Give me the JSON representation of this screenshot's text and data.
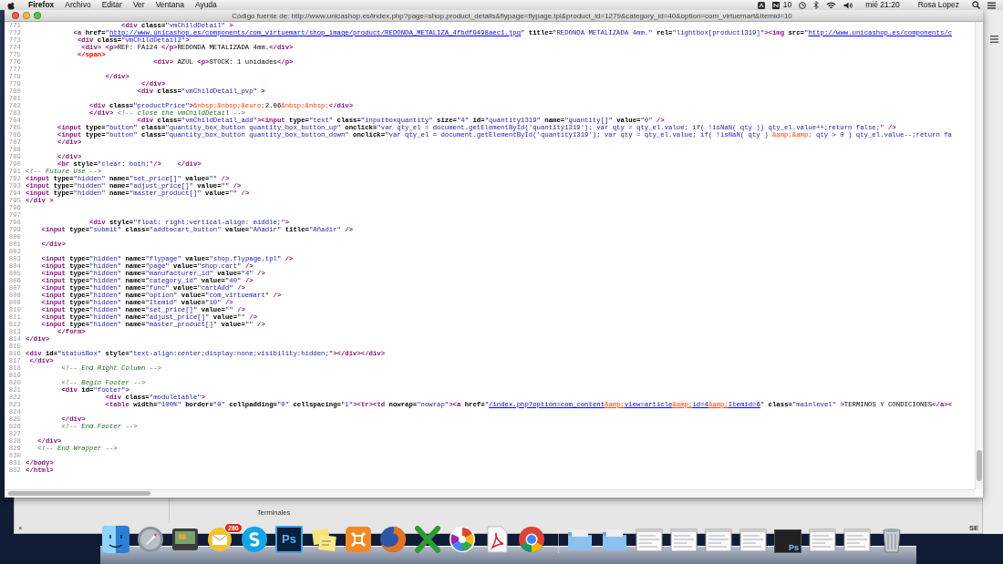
{
  "menubar": {
    "app_name": "Firefox",
    "menus": [
      "Archivo",
      "Editar",
      "Ver",
      "Ventana",
      "Ayuda"
    ],
    "status_count": "10",
    "clock": "mié 21:20",
    "user": "Rosa Lopez"
  },
  "window": {
    "title": "Código fuente de: http://www.unicashop.es/index.php?page=shop.product_details&flypage=flypage.tpl&product_id=1279&category_id=40&option=com_virtuemart&Itemid=10",
    "lines": [
      {
        "number": "771",
        "tokens": [
          {
            "kind": "tag",
            "text": "                        <div"
          },
          {
            "kind": "attr",
            "text": " class="
          },
          {
            "kind": "value",
            "text": "\"vmChildDetail\""
          },
          {
            "kind": "tag",
            "text": " >"
          }
        ]
      },
      {
        "number": "772",
        "tokens": [
          {
            "kind": "tag",
            "text": "            <a"
          },
          {
            "kind": "attr",
            "text": " href="
          },
          {
            "kind": "value",
            "text": "\""
          },
          {
            "kind": "link",
            "parts": [
              {
                "kind": "url",
                "text": "http://www.unicashop.es/components/com_virtuemart/shop_image/product/REDONDA_METALIZA_4fbdf9498aec1.jpg"
              }
            ]
          },
          {
            "kind": "value",
            "text": "\""
          },
          {
            "kind": "attr",
            "text": " title="
          },
          {
            "kind": "value",
            "text": "\"REDONDA METALIZADA 4mm.\""
          },
          {
            "kind": "attr",
            "text": " rel="
          },
          {
            "kind": "value",
            "text": "\"lightbox[product1319]\""
          },
          {
            "kind": "tag",
            "text": "><img"
          },
          {
            "kind": "attr",
            "text": " src="
          },
          {
            "kind": "value",
            "text": "\""
          },
          {
            "kind": "link",
            "parts": [
              {
                "kind": "url",
                "text": "http://www.unicashop.es/components/c"
              }
            ]
          }
        ]
      },
      {
        "number": "773",
        "tokens": [
          {
            "kind": "tag",
            "text": "             <div"
          },
          {
            "kind": "attr",
            "text": " class="
          },
          {
            "kind": "value",
            "text": "\"vmChildDetail2\""
          },
          {
            "kind": "tag",
            "text": ">"
          }
        ]
      },
      {
        "number": "774",
        "tokens": [
          {
            "kind": "tag",
            "text": "              <div> "
          },
          {
            "kind": "tag",
            "text": "<p>"
          },
          {
            "kind": "text",
            "text": "REF: FA124 "
          },
          {
            "kind": "tag",
            "text": "</p>"
          },
          {
            "kind": "text",
            "text": "REDONDA METALIZADA 4mm."
          },
          {
            "kind": "tag",
            "text": "</div>"
          }
        ]
      },
      {
        "number": "775",
        "tokens": [
          {
            "kind": "error",
            "text": "             </span>"
          }
        ]
      },
      {
        "number": "776",
        "tokens": [
          {
            "kind": "tag",
            "text": "                                <div>"
          },
          {
            "kind": "text",
            "text": " AZUL "
          },
          {
            "kind": "tag",
            "text": "<p>"
          },
          {
            "kind": "text",
            "text": "STOCK: 1 unidades"
          },
          {
            "kind": "tag",
            "text": "</p>"
          }
        ]
      },
      {
        "number": "777"
      },
      {
        "number": "778",
        "tokens": [
          {
            "kind": "tag",
            "text": "                    </div>"
          }
        ]
      },
      {
        "number": "779",
        "tokens": [
          {
            "kind": "tag",
            "text": "                             </div>"
          }
        ]
      },
      {
        "number": "780",
        "tokens": [
          {
            "kind": "tag",
            "text": "                            <div"
          },
          {
            "kind": "attr",
            "text": " class="
          },
          {
            "kind": "value",
            "text": "\"vmChildDetail_pvp\""
          },
          {
            "kind": "tag",
            "text": " >"
          }
        ]
      },
      {
        "number": "781"
      },
      {
        "number": "782",
        "tokens": [
          {
            "kind": "tag",
            "text": "                <div"
          },
          {
            "kind": "attr",
            "text": " class="
          },
          {
            "kind": "value",
            "text": "\"productPrice\""
          },
          {
            "kind": "tag",
            "text": ">"
          },
          {
            "kind": "entity",
            "text": "&nbsp;&nbsp;&euro;"
          },
          {
            "kind": "text",
            "text": "2.06"
          },
          {
            "kind": "entity",
            "text": "&nbsp;&nbsp;"
          },
          {
            "kind": "tag",
            "text": "</div>"
          }
        ]
      },
      {
        "number": "783",
        "tokens": [
          {
            "kind": "tag",
            "text": "                </div> "
          },
          {
            "kind": "comment",
            "text": "<!-- close the vmChildDetail -->"
          }
        ]
      },
      {
        "number": "784",
        "tokens": [
          {
            "kind": "tag",
            "text": "                            <div"
          },
          {
            "kind": "attr",
            "text": " class="
          },
          {
            "kind": "value",
            "text": "\"vmChildDetail_add\""
          },
          {
            "kind": "tag",
            "text": "><input"
          },
          {
            "kind": "attr",
            "text": " type="
          },
          {
            "kind": "value",
            "text": "\"text\""
          },
          {
            "kind": "attr",
            "text": " class="
          },
          {
            "kind": "value",
            "text": "\"inputboxquantity\""
          },
          {
            "kind": "attr",
            "text": " size="
          },
          {
            "kind": "value",
            "text": "\"4\""
          },
          {
            "kind": "attr",
            "text": " id="
          },
          {
            "kind": "value",
            "text": "\"quantity1319\""
          },
          {
            "kind": "attr",
            "text": " name="
          },
          {
            "kind": "value",
            "text": "\"quantity[]\""
          },
          {
            "kind": "attr",
            "text": " value="
          },
          {
            "kind": "value",
            "text": "\"0\""
          },
          {
            "kind": "tag",
            "text": " />"
          }
        ]
      },
      {
        "number": "785",
        "tokens": [
          {
            "kind": "tag",
            "text": "        <input"
          },
          {
            "kind": "attr",
            "text": " type="
          },
          {
            "kind": "value",
            "text": "\"button\""
          },
          {
            "kind": "attr",
            "text": " class="
          },
          {
            "kind": "value",
            "text": "\"quantity_box_button quantity_box_button_up\""
          },
          {
            "kind": "attr",
            "text": " onclick="
          },
          {
            "kind": "value",
            "text": "\"var qty_el = document.getElementById('quantity1319'); var qty = qty_el.value; if( !isNaN( qty )) qty_el.value++;return false;\""
          },
          {
            "kind": "tag",
            "text": " />"
          }
        ]
      },
      {
        "number": "786",
        "tokens": [
          {
            "kind": "tag",
            "text": "        <input"
          },
          {
            "kind": "attr",
            "text": " type="
          },
          {
            "kind": "value",
            "text": "\"button\""
          },
          {
            "kind": "attr",
            "text": " class="
          },
          {
            "kind": "value",
            "text": "\"quantity_box_button quantity_box_button_down\""
          },
          {
            "kind": "attr",
            "text": " onclick="
          },
          {
            "kind": "value",
            "text": "\"var qty_el = document.getElementById('quantity1319'); var qty = qty_el.value; if( !isNaN( qty ) "
          },
          {
            "kind": "entity",
            "text": "&amp;&amp;"
          },
          {
            "kind": "value",
            "text": " qty > 0 ) qty_el.value--;return fa"
          }
        ]
      },
      {
        "number": "787",
        "tokens": [
          {
            "kind": "tag",
            "text": "        </div>"
          }
        ]
      },
      {
        "number": "788"
      },
      {
        "number": "789",
        "tokens": [
          {
            "kind": "tag",
            "text": "        </div>"
          }
        ]
      },
      {
        "number": "790",
        "tokens": [
          {
            "kind": "tag",
            "text": "        <br"
          },
          {
            "kind": "attr",
            "text": " style="
          },
          {
            "kind": "value",
            "text": "\"clear: both;\""
          },
          {
            "kind": "tag",
            "text": "/>    </div>"
          }
        ]
      },
      {
        "number": "791",
        "tokens": [
          {
            "kind": "comment",
            "text": "<!-- Future Use -->"
          }
        ]
      },
      {
        "number": "792",
        "tokens": [
          {
            "kind": "tag",
            "text": "<input"
          },
          {
            "kind": "attr",
            "text": " type="
          },
          {
            "kind": "value",
            "text": "\"hidden\""
          },
          {
            "kind": "attr",
            "text": " name="
          },
          {
            "kind": "value",
            "text": "\"set_price[]\""
          },
          {
            "kind": "attr",
            "text": " value="
          },
          {
            "kind": "value",
            "text": "\"\""
          },
          {
            "kind": "tag",
            "text": " />"
          }
        ]
      },
      {
        "number": "793",
        "tokens": [
          {
            "kind": "tag",
            "text": "<input"
          },
          {
            "kind": "attr",
            "text": " type="
          },
          {
            "kind": "value",
            "text": "\"hidden\""
          },
          {
            "kind": "attr",
            "text": " name="
          },
          {
            "kind": "value",
            "text": "\"adjust_price[]\""
          },
          {
            "kind": "attr",
            "text": " value="
          },
          {
            "kind": "value",
            "text": "\"\""
          },
          {
            "kind": "tag",
            "text": " />"
          }
        ]
      },
      {
        "number": "794",
        "tokens": [
          {
            "kind": "tag",
            "text": "<input"
          },
          {
            "kind": "attr",
            "text": " type="
          },
          {
            "kind": "value",
            "text": "\"hidden\""
          },
          {
            "kind": "attr",
            "text": " name="
          },
          {
            "kind": "value",
            "text": "\"master_product[]\""
          },
          {
            "kind": "attr",
            "text": " value="
          },
          {
            "kind": "value",
            "text": "\"\""
          },
          {
            "kind": "tag",
            "text": " />"
          }
        ]
      },
      {
        "number": "795",
        "tokens": [
          {
            "kind": "tag",
            "text": "</div >"
          }
        ]
      },
      {
        "number": "796"
      },
      {
        "number": "797"
      },
      {
        "number": "798",
        "tokens": [
          {
            "kind": "tag",
            "text": "                <div"
          },
          {
            "kind": "attr",
            "text": " style="
          },
          {
            "kind": "value",
            "text": "\"float: right;vertical-align: middle;\""
          },
          {
            "kind": "tag",
            "text": ">"
          }
        ]
      },
      {
        "number": "799",
        "tokens": [
          {
            "kind": "tag",
            "text": "    <input"
          },
          {
            "kind": "attr",
            "text": " type="
          },
          {
            "kind": "value",
            "text": "\"submit\""
          },
          {
            "kind": "attr",
            "text": " class="
          },
          {
            "kind": "value",
            "text": "\"addtocart_button\""
          },
          {
            "kind": "attr",
            "text": " value="
          },
          {
            "kind": "value",
            "text": "\"Añadir\""
          },
          {
            "kind": "attr",
            "text": " title="
          },
          {
            "kind": "value",
            "text": "\"Añadir\""
          },
          {
            "kind": "tag",
            "text": " />"
          }
        ]
      },
      {
        "number": "800"
      },
      {
        "number": "801",
        "tokens": [
          {
            "kind": "tag",
            "text": "    </div>"
          }
        ]
      },
      {
        "number": "802"
      },
      {
        "number": "803",
        "tokens": [
          {
            "kind": "tag",
            "text": "    <input"
          },
          {
            "kind": "attr",
            "text": " type="
          },
          {
            "kind": "value",
            "text": "\"hidden\""
          },
          {
            "kind": "attr",
            "text": " name="
          },
          {
            "kind": "value",
            "text": "\"flypage\""
          },
          {
            "kind": "attr",
            "text": " value="
          },
          {
            "kind": "value",
            "text": "\"shop.flypage.tpl\""
          },
          {
            "kind": "tag",
            "text": " />"
          }
        ]
      },
      {
        "number": "804",
        "tokens": [
          {
            "kind": "tag",
            "text": "    <input"
          },
          {
            "kind": "attr",
            "text": " type="
          },
          {
            "kind": "value",
            "text": "\"hidden\""
          },
          {
            "kind": "attr",
            "text": " name="
          },
          {
            "kind": "value",
            "text": "\"page\""
          },
          {
            "kind": "attr",
            "text": " value="
          },
          {
            "kind": "value",
            "text": "\"shop.cart\""
          },
          {
            "kind": "tag",
            "text": " />"
          }
        ]
      },
      {
        "number": "805",
        "tokens": [
          {
            "kind": "tag",
            "text": "    <input"
          },
          {
            "kind": "attr",
            "text": " type="
          },
          {
            "kind": "value",
            "text": "\"hidden\""
          },
          {
            "kind": "attr",
            "text": " name="
          },
          {
            "kind": "value",
            "text": "\"manufacturer_id\""
          },
          {
            "kind": "attr",
            "text": " value="
          },
          {
            "kind": "value",
            "text": "\"4\""
          },
          {
            "kind": "tag",
            "text": " />"
          }
        ]
      },
      {
        "number": "806",
        "tokens": [
          {
            "kind": "tag",
            "text": "    <input"
          },
          {
            "kind": "attr",
            "text": " type="
          },
          {
            "kind": "value",
            "text": "\"hidden\""
          },
          {
            "kind": "attr",
            "text": " name="
          },
          {
            "kind": "value",
            "text": "\"category_id\""
          },
          {
            "kind": "attr",
            "text": " value="
          },
          {
            "kind": "value",
            "text": "\"40\""
          },
          {
            "kind": "tag",
            "text": " />"
          }
        ]
      },
      {
        "number": "807",
        "tokens": [
          {
            "kind": "tag",
            "text": "    <input"
          },
          {
            "kind": "attr",
            "text": " type="
          },
          {
            "kind": "value",
            "text": "\"hidden\""
          },
          {
            "kind": "attr",
            "text": " name="
          },
          {
            "kind": "value",
            "text": "\"func\""
          },
          {
            "kind": "attr",
            "text": " value="
          },
          {
            "kind": "value",
            "text": "\"cartAdd\""
          },
          {
            "kind": "tag",
            "text": " />"
          }
        ]
      },
      {
        "number": "808",
        "tokens": [
          {
            "kind": "tag",
            "text": "    <input"
          },
          {
            "kind": "attr",
            "text": " type="
          },
          {
            "kind": "value",
            "text": "\"hidden\""
          },
          {
            "kind": "attr",
            "text": " name="
          },
          {
            "kind": "value",
            "text": "\"option\""
          },
          {
            "kind": "attr",
            "text": " value="
          },
          {
            "kind": "value",
            "text": "\"com_virtuemart\""
          },
          {
            "kind": "tag",
            "text": " />"
          }
        ]
      },
      {
        "number": "809",
        "tokens": [
          {
            "kind": "tag",
            "text": "    <input"
          },
          {
            "kind": "attr",
            "text": " type="
          },
          {
            "kind": "value",
            "text": "\"hidden\""
          },
          {
            "kind": "attr",
            "text": " name="
          },
          {
            "kind": "value",
            "text": "\"Itemid\""
          },
          {
            "kind": "attr",
            "text": " value="
          },
          {
            "kind": "value",
            "text": "\"10\""
          },
          {
            "kind": "tag",
            "text": " />"
          }
        ]
      },
      {
        "number": "810",
        "tokens": [
          {
            "kind": "tag",
            "text": "    <input"
          },
          {
            "kind": "attr",
            "text": " type="
          },
          {
            "kind": "value",
            "text": "\"hidden\""
          },
          {
            "kind": "attr",
            "text": " name="
          },
          {
            "kind": "value",
            "text": "\"set_price[]\""
          },
          {
            "kind": "attr",
            "text": " value="
          },
          {
            "kind": "value",
            "text": "\"\""
          },
          {
            "kind": "tag",
            "text": " />"
          }
        ]
      },
      {
        "number": "811",
        "tokens": [
          {
            "kind": "tag",
            "text": "    <input"
          },
          {
            "kind": "attr",
            "text": " type="
          },
          {
            "kind": "value",
            "text": "\"hidden\""
          },
          {
            "kind": "attr",
            "text": " name="
          },
          {
            "kind": "value",
            "text": "\"adjust_price[]\""
          },
          {
            "kind": "attr",
            "text": " value="
          },
          {
            "kind": "value",
            "text": "\"\""
          },
          {
            "kind": "tag",
            "text": " />"
          }
        ]
      },
      {
        "number": "812",
        "tokens": [
          {
            "kind": "tag",
            "text": "    <input"
          },
          {
            "kind": "attr",
            "text": " type="
          },
          {
            "kind": "value",
            "text": "\"hidden\""
          },
          {
            "kind": "attr",
            "text": " name="
          },
          {
            "kind": "value",
            "text": "\"master_product[]\""
          },
          {
            "kind": "attr",
            "text": " value="
          },
          {
            "kind": "value",
            "text": "\"\""
          },
          {
            "kind": "tag",
            "text": " />"
          }
        ]
      },
      {
        "number": "813",
        "tokens": [
          {
            "kind": "tag",
            "text": "        </form>"
          }
        ]
      },
      {
        "number": "814",
        "tokens": [
          {
            "kind": "tag",
            "text": "</div>"
          }
        ]
      },
      {
        "number": "815"
      },
      {
        "number": "816",
        "tokens": [
          {
            "kind": "tag",
            "text": "<div"
          },
          {
            "kind": "attr",
            "text": " id="
          },
          {
            "kind": "value",
            "text": "\"statusBox\""
          },
          {
            "kind": "attr",
            "text": " style="
          },
          {
            "kind": "value",
            "text": "\"text-align:center;display:none;visibility:hidden;\""
          },
          {
            "kind": "tag",
            "text": "></div></div>"
          }
        ]
      },
      {
        "number": "817",
        "tokens": [
          {
            "kind": "tag",
            "text": " </div>"
          }
        ]
      },
      {
        "number": "818",
        "tokens": [
          {
            "kind": "comment",
            "text": "         <!-- End Right Column -->"
          }
        ]
      },
      {
        "number": "819"
      },
      {
        "number": "820",
        "tokens": [
          {
            "kind": "comment",
            "text": "         <!-- Begin Footer -->"
          }
        ]
      },
      {
        "number": "821",
        "tokens": [
          {
            "kind": "tag",
            "text": "         <div"
          },
          {
            "kind": "attr",
            "text": " id="
          },
          {
            "kind": "value",
            "text": "\"footer\""
          },
          {
            "kind": "tag",
            "text": ">"
          }
        ]
      },
      {
        "number": "822",
        "tokens": [
          {
            "kind": "tag",
            "text": "                    <div"
          },
          {
            "kind": "attr",
            "text": " class="
          },
          {
            "kind": "value",
            "text": "\"moduletable\""
          },
          {
            "kind": "tag",
            "text": ">"
          }
        ]
      },
      {
        "number": "823",
        "tokens": [
          {
            "kind": "tag",
            "text": "                    <table"
          },
          {
            "kind": "attr",
            "text": " width="
          },
          {
            "kind": "value",
            "text": "\"100%\""
          },
          {
            "kind": "attr",
            "text": " border="
          },
          {
            "kind": "value",
            "text": "\"0\""
          },
          {
            "kind": "attr",
            "text": " cellpadding="
          },
          {
            "kind": "value",
            "text": "\"0\""
          },
          {
            "kind": "attr",
            "text": " cellspacing="
          },
          {
            "kind": "value",
            "text": "\"1\""
          },
          {
            "kind": "tag",
            "text": "><tr><td"
          },
          {
            "kind": "attr",
            "text": " nowrap="
          },
          {
            "kind": "value",
            "text": "\"nowrap\""
          },
          {
            "kind": "tag",
            "text": "><a"
          },
          {
            "kind": "attr",
            "text": " href="
          },
          {
            "kind": "value",
            "text": "\""
          },
          {
            "kind": "link",
            "parts": [
              {
                "kind": "url",
                "text": "/index.php?option=com_content"
              },
              {
                "kind": "entity",
                "text": "&amp;"
              },
              {
                "kind": "url",
                "text": "view=article"
              },
              {
                "kind": "entity",
                "text": "&amp;"
              },
              {
                "kind": "url",
                "text": "id=4"
              },
              {
                "kind": "entity",
                "text": "&amp;"
              },
              {
                "kind": "url",
                "text": "Itemid=6"
              }
            ]
          },
          {
            "kind": "value",
            "text": "\""
          },
          {
            "kind": "attr",
            "text": " class="
          },
          {
            "kind": "value",
            "text": "\"mainlevel\""
          },
          {
            "kind": "tag",
            "text": " >"
          },
          {
            "kind": "text",
            "text": "TERMINOS Y CONDICIONES"
          },
          {
            "kind": "tag",
            "text": "</a><"
          }
        ]
      },
      {
        "number": "824"
      },
      {
        "number": "825",
        "tokens": [
          {
            "kind": "tag",
            "text": "         </div>"
          }
        ]
      },
      {
        "number": "826",
        "tokens": [
          {
            "kind": "comment",
            "text": "         <!-- End Footer -->"
          }
        ]
      },
      {
        "number": "827"
      },
      {
        "number": "828",
        "tokens": [
          {
            "kind": "tag",
            "text": "   </div>"
          }
        ]
      },
      {
        "number": "829",
        "tokens": [
          {
            "kind": "comment",
            "text": "   <!-- End Wrapper -->"
          }
        ]
      },
      {
        "number": "830"
      },
      {
        "number": "831",
        "tokens": [
          {
            "kind": "tag",
            "text": "</body>"
          }
        ]
      },
      {
        "number": "832",
        "tokens": [
          {
            "kind": "tag",
            "text": "</html>"
          }
        ]
      }
    ]
  },
  "back_window": {
    "title": "Terminales",
    "close": "×",
    "corner": "SE"
  },
  "dock": {
    "items": [
      {
        "kind": "finder"
      },
      {
        "kind": "rocket"
      },
      {
        "kind": "monitor"
      },
      {
        "kind": "mail",
        "badge": "286"
      },
      {
        "kind": "round"
      },
      {
        "kind": "labeled",
        "label": "Ps"
      },
      {
        "kind": "notes"
      },
      {
        "kind": "square"
      },
      {
        "kind": "globe"
      },
      {
        "kind": "cross"
      },
      {
        "kind": "pinwheel"
      },
      {
        "kind": "document"
      },
      {
        "kind": "ring"
      },
      {
        "kind": "separator"
      },
      {
        "kind": "folder"
      },
      {
        "kind": "folder"
      },
      {
        "kind": "thumbnail"
      },
      {
        "kind": "thumbnail"
      },
      {
        "kind": "thumbnail"
      },
      {
        "kind": "thumbnail"
      },
      {
        "kind": "dark-thumbnail",
        "label": "Ps"
      },
      {
        "kind": "thumbnail"
      },
      {
        "kind": "thumbnail"
      },
      {
        "kind": "trash"
      }
    ]
  }
}
